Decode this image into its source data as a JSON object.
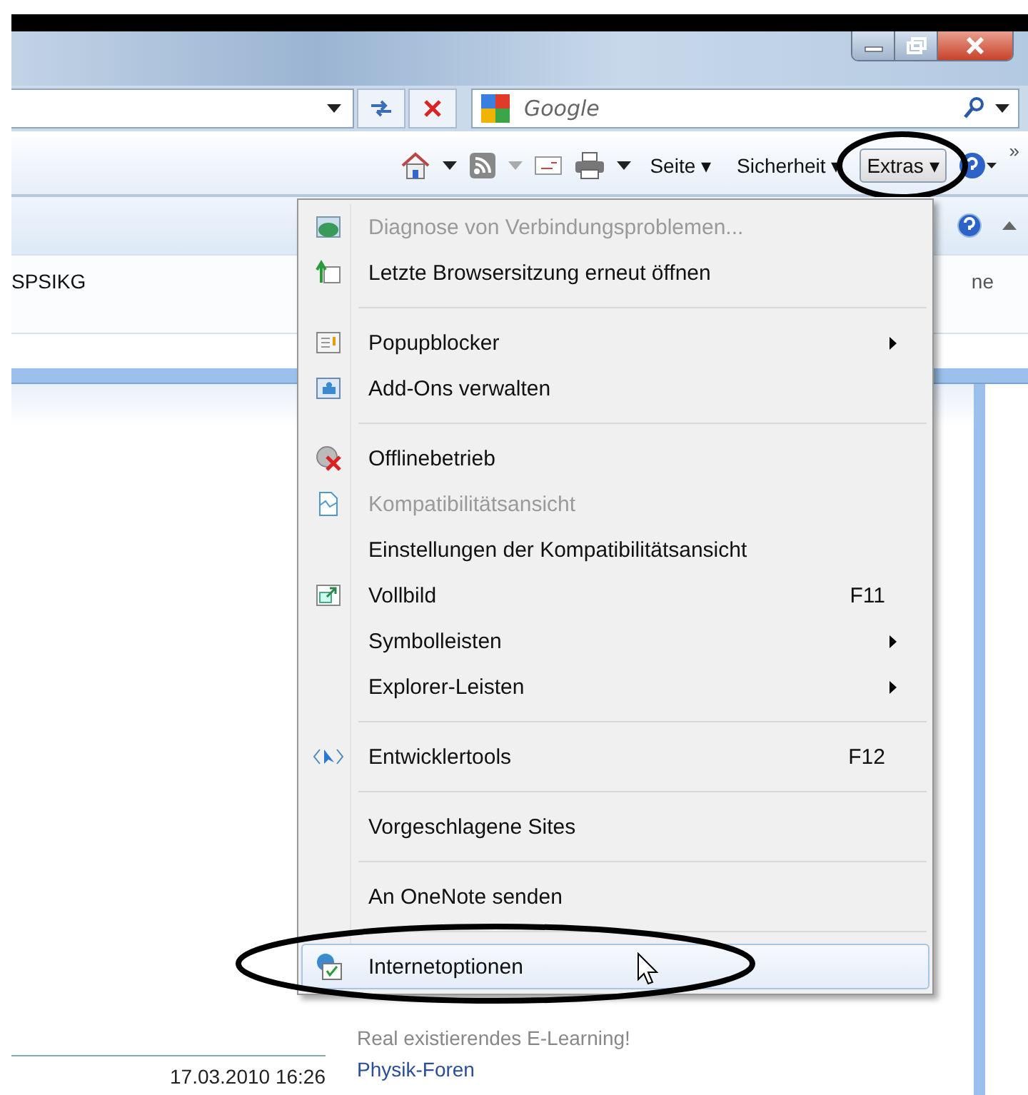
{
  "search": {
    "placeholder": "Google"
  },
  "command_bar": [
    {
      "label": "Seite ▾",
      "selected": false
    },
    {
      "label": "Sicherheit ▾",
      "selected": false
    },
    {
      "label": "Extras ▾",
      "selected": true
    }
  ],
  "command_overflow": "»",
  "page": {
    "field_value": "SPSIKG",
    "cut_text": "ne",
    "behind_menu_text": "Real existierendes E-Learning!",
    "date": "17.03.2010 16:26",
    "link": "Physik-Foren"
  },
  "menu": [
    {
      "kind": "item",
      "label": "Diagnose von Verbindungsproblemen...",
      "disabled": true,
      "selected": false
    },
    {
      "kind": "item",
      "label": "Letzte Browsersitzung erneut öffnen",
      "disabled": false,
      "selected": false
    },
    {
      "kind": "separator"
    },
    {
      "kind": "item",
      "label": "Popupblocker",
      "disabled": false,
      "selected": false,
      "submenu": true
    },
    {
      "kind": "item",
      "label": "Add-Ons verwalten",
      "disabled": false,
      "selected": false
    },
    {
      "kind": "separator"
    },
    {
      "kind": "item",
      "label": "Offlinebetrieb",
      "disabled": false,
      "selected": false
    },
    {
      "kind": "item",
      "label": "Kompatibilitätsansicht",
      "disabled": true,
      "selected": false
    },
    {
      "kind": "item",
      "label": "Einstellungen der Kompatibilitätsansicht",
      "disabled": false,
      "selected": false
    },
    {
      "kind": "item",
      "label": "Vollbild",
      "disabled": false,
      "selected": false,
      "shortcut": "F11"
    },
    {
      "kind": "item",
      "label": "Symbolleisten",
      "disabled": false,
      "selected": false,
      "submenu": true
    },
    {
      "kind": "item",
      "label": "Explorer-Leisten",
      "disabled": false,
      "selected": false,
      "submenu": true
    },
    {
      "kind": "separator"
    },
    {
      "kind": "item",
      "label": "Entwicklertools",
      "disabled": false,
      "selected": false,
      "shortcut": "F12"
    },
    {
      "kind": "separator"
    },
    {
      "kind": "item",
      "label": "Vorgeschlagene Sites",
      "disabled": false,
      "selected": false
    },
    {
      "kind": "separator"
    },
    {
      "kind": "item",
      "label": "An OneNote senden",
      "disabled": false,
      "selected": false
    },
    {
      "kind": "separator"
    },
    {
      "kind": "item",
      "label": "Internetoptionen",
      "disabled": false,
      "selected": true
    }
  ]
}
